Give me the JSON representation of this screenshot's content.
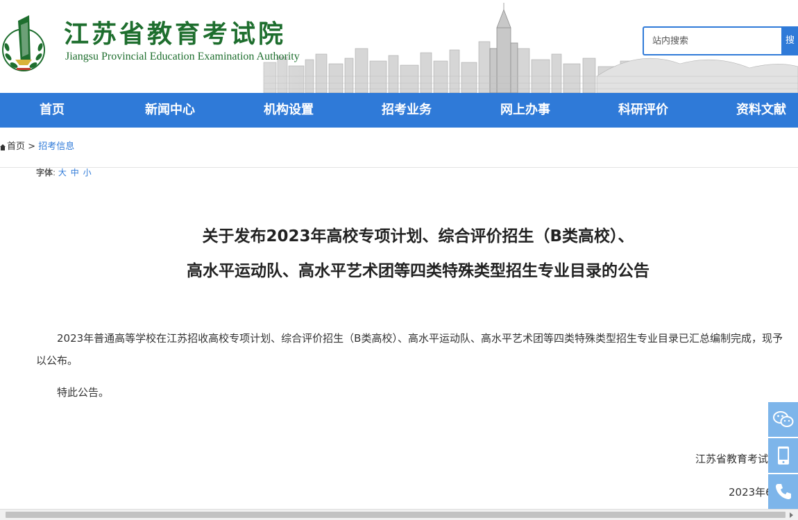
{
  "header": {
    "title_cn": "江苏省教育考试院",
    "title_en": "Jiangsu Provincial Education Examination Authority",
    "emblem_icon": "jsea-emblem-icon",
    "brand_color": "#1e6e2e"
  },
  "search": {
    "placeholder": "站内搜索",
    "button_label": "搜"
  },
  "nav": {
    "items": [
      {
        "label": "首页"
      },
      {
        "label": "新闻中心"
      },
      {
        "label": "机构设置"
      },
      {
        "label": "招考业务"
      },
      {
        "label": "网上办事"
      },
      {
        "label": "科研评价"
      },
      {
        "label": "资料文献"
      }
    ],
    "color": "#2f7ad8"
  },
  "breadcrumb": {
    "home_label": "首页",
    "separator": ">",
    "current_label": "招考信息"
  },
  "font_switch": {
    "label": "字体",
    "colon": ":",
    "options": [
      "大",
      "中",
      "小"
    ]
  },
  "article": {
    "title_line1": "关于发布2023年高校专项计划、综合评价招生（B类高校）、",
    "title_line2": "高水平运动队、高水平艺术团等四类特殊类型招生专业目录的公告",
    "paragraph1": "2023年普通高等学校在江苏招收高校专项计划、综合评价招生（B类高校）、高水平运动队、高水平艺术团等四类特殊类型招生专业目录已汇总编制完成，现予以公布。",
    "paragraph2": "特此公告。",
    "sign_org": "江苏省教育考试",
    "sign_date": "2023年6"
  },
  "side_tools": [
    "wechat-icon",
    "mobile-icon",
    "phone-icon"
  ]
}
